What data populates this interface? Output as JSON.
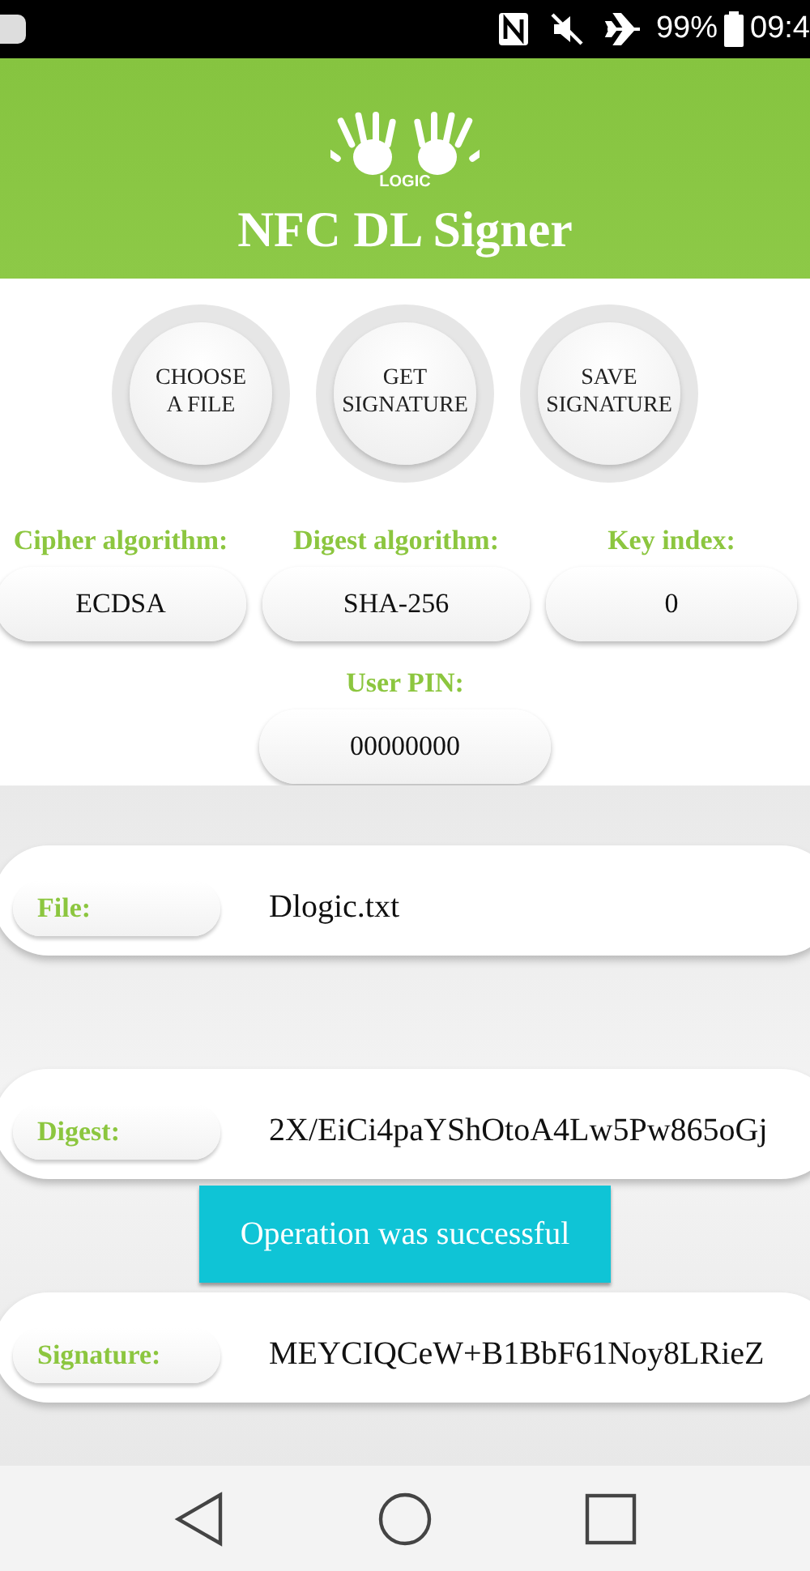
{
  "status_bar": {
    "battery": "99%",
    "time": "09:4"
  },
  "header": {
    "logo_text": "LOGIC",
    "title": "NFC DL Signer"
  },
  "action_buttons": [
    {
      "label": "CHOOSE\nA FILE"
    },
    {
      "label": "GET\nSIGNATURE"
    },
    {
      "label": "SAVE\nSIGNATURE"
    }
  ],
  "settings": [
    {
      "label": "Cipher algorithm:",
      "value": "ECDSA"
    },
    {
      "label": "Digest algorithm:",
      "value": "SHA-256"
    },
    {
      "label": "Key index:",
      "value": "0"
    }
  ],
  "pin": {
    "label": "User PIN:",
    "value": "00000000"
  },
  "results": [
    {
      "label": "File:",
      "value": "Dlogic.txt"
    },
    {
      "label": "Digest:",
      "value": "2X/EiCi4paYShOtoA4Lw5Pw865oGj"
    },
    {
      "label": "Signature:",
      "value": "MEYCIQCeW+B1BbF61Noy8LRieZ"
    }
  ],
  "toast": "Operation was successful"
}
